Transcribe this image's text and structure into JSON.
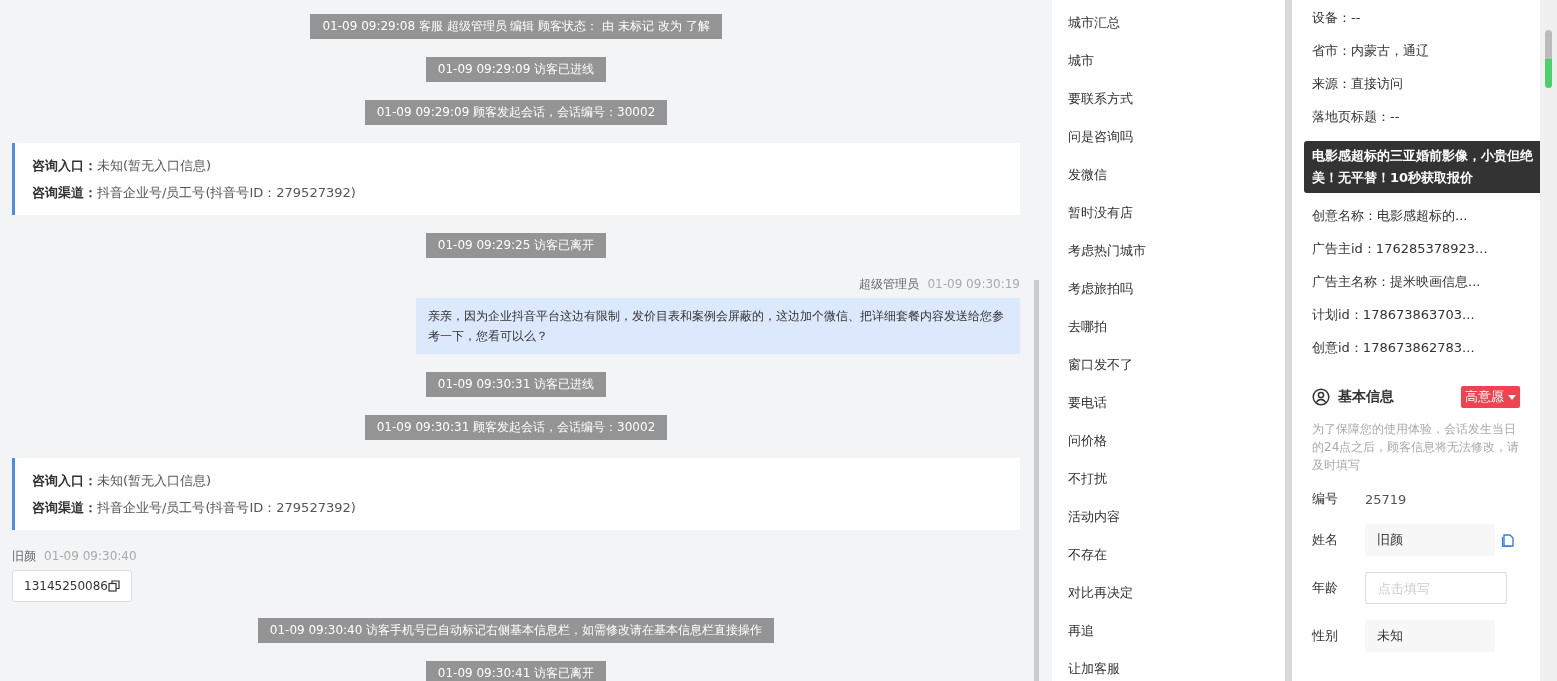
{
  "chat": [
    {
      "kind": "system",
      "text": "01-09 09:29:08 客服 超级管理员 编辑 顾客状态： 由 未标记 改为 了解"
    },
    {
      "kind": "system",
      "text": "01-09 09:29:09 访客已进线"
    },
    {
      "kind": "system",
      "text": "01-09 09:29:09 顾客发起会话，会话编号：30002"
    },
    {
      "kind": "info",
      "lines": [
        {
          "label": "咨询入口：",
          "value": "未知(暂无入口信息)"
        },
        {
          "label": "咨询渠道：",
          "value": "抖音企业号/员工号(抖音号ID：279527392)"
        }
      ]
    },
    {
      "kind": "system",
      "text": "01-09 09:29:25 访客已离开"
    },
    {
      "kind": "agent",
      "sender": "超级管理员",
      "time": "01-09 09:30:19",
      "text": "亲亲，因为企业抖音平台这边有限制，发价目表和案例会屏蔽的，这边加个微信、把详细套餐内容发送给您参考一下，您看可以么？"
    },
    {
      "kind": "system",
      "text": "01-09 09:30:31 访客已进线"
    },
    {
      "kind": "system",
      "text": "01-09 09:30:31 顾客发起会话，会话编号：30002"
    },
    {
      "kind": "info",
      "lines": [
        {
          "label": "咨询入口：",
          "value": "未知(暂无入口信息)"
        },
        {
          "label": "咨询渠道：",
          "value": "抖音企业号/员工号(抖音号ID：279527392)"
        }
      ]
    },
    {
      "kind": "visitor",
      "sender": "旧颜",
      "time": "01-09 09:30:40",
      "text": "13145250086"
    },
    {
      "kind": "system",
      "text": "01-09 09:30:40 访客手机号已自动标记右侧基本信息栏，如需修改请在基本信息栏直接操作"
    },
    {
      "kind": "system",
      "text": "01-09 09:30:41 访客已离开"
    }
  ],
  "quick_replies": [
    "城市汇总",
    "城市",
    "要联系方式",
    "问是咨询吗",
    "发微信",
    "暂时没有店",
    "考虑热门城市",
    "考虑旅拍吗",
    "去哪拍",
    "窗口发不了",
    "要电话",
    "问价格",
    "不打扰",
    "活动内容",
    "不存在",
    "对比再决定",
    "再追",
    "让加客服"
  ],
  "visitor_info_top": [
    "设备：--",
    "省市：内蒙古，通辽",
    "来源：直接访问",
    "落地页标题：--"
  ],
  "tooltip": "电影感超标的三亚婚前影像，小贵但绝美！无平替！10秒获取报价",
  "visitor_info_bottom": [
    "创意名称：电影感超标的...",
    "广告主id：176285378923...",
    "广告主名称：提米映画信息...",
    "计划id：178673863703...",
    "创意id：178673862783..."
  ],
  "basic_info": {
    "title": "基本信息",
    "intent": "高意愿",
    "note": "为了保障您的使用体验，会话发生当日的24点之后，顾客信息将无法修改，请及时填写",
    "fields": [
      {
        "kind": "plain",
        "label": "编号",
        "value": "25719"
      },
      {
        "kind": "copyable",
        "label": "姓名",
        "value": "旧颜"
      },
      {
        "kind": "input",
        "label": "年龄",
        "placeholder": "点击填写"
      },
      {
        "kind": "filled",
        "label": "性别",
        "value": "未知"
      }
    ]
  }
}
